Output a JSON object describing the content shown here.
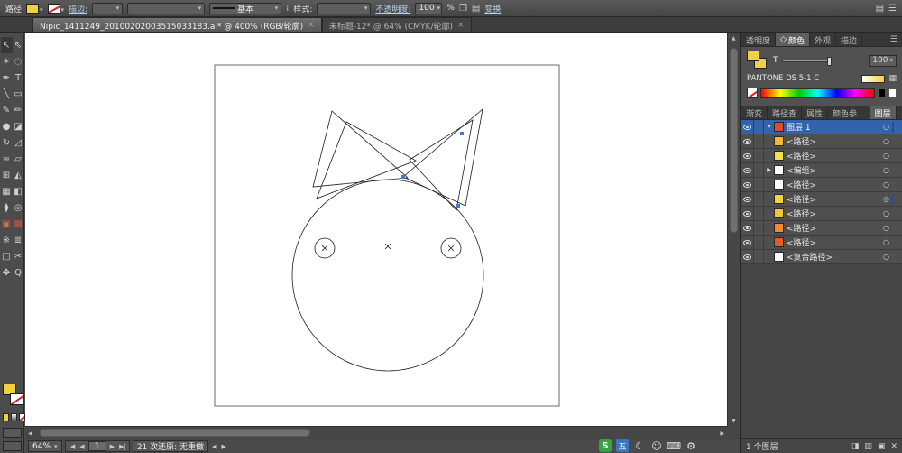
{
  "control_bar": {
    "selection_label": "路径",
    "stroke_link": "描边:",
    "profile_value": "基本",
    "style_label": "样式:",
    "opacity_link": "不透明度:",
    "opacity_value": "100",
    "percent": "%",
    "transform_link": "变换"
  },
  "document_tabs": {
    "active_title": "Nipic_1411249_20100202003515033183.ai* @ 400% (RGB/轮廓)",
    "inactive_title": "未标题-12* @ 64% (CMYK/轮廓)"
  },
  "toolbar": {
    "tools": [
      {
        "name": "selection-tool",
        "glyph": "↖"
      },
      {
        "name": "direct-selection-tool",
        "glyph": "⇖"
      },
      {
        "name": "magic-wand-tool",
        "glyph": "✶"
      },
      {
        "name": "lasso-tool",
        "glyph": "◌"
      },
      {
        "name": "pen-tool",
        "glyph": "✒"
      },
      {
        "name": "type-tool",
        "glyph": "T"
      },
      {
        "name": "line-segment-tool",
        "glyph": "╲"
      },
      {
        "name": "rectangle-tool",
        "glyph": "▭"
      },
      {
        "name": "paintbrush-tool",
        "glyph": "✎"
      },
      {
        "name": "pencil-tool",
        "glyph": "✏"
      },
      {
        "name": "blob-brush-tool",
        "glyph": "●"
      },
      {
        "name": "eraser-tool",
        "glyph": "◪"
      },
      {
        "name": "rotate-tool",
        "glyph": "↻"
      },
      {
        "name": "scale-tool",
        "glyph": "◿"
      },
      {
        "name": "width-tool",
        "glyph": "≈"
      },
      {
        "name": "free-transform-tool",
        "glyph": "▱"
      },
      {
        "name": "shape-builder-tool",
        "glyph": "⊞"
      },
      {
        "name": "perspective-grid-tool",
        "glyph": "◭"
      },
      {
        "name": "mesh-tool",
        "glyph": "▦"
      },
      {
        "name": "gradient-tool",
        "glyph": "◧"
      },
      {
        "name": "eyedropper-tool",
        "glyph": "⧫"
      },
      {
        "name": "blend-tool",
        "glyph": "◎"
      },
      {
        "name": "live-paint-bucket-tool",
        "glyph": "▣",
        "color": "#e06a3c"
      },
      {
        "name": "live-paint-selection-tool",
        "glyph": "▩",
        "color": "#d05050"
      },
      {
        "name": "symbol-sprayer-tool",
        "glyph": "※"
      },
      {
        "name": "column-graph-tool",
        "glyph": "≣"
      },
      {
        "name": "artboard-tool",
        "glyph": "□"
      },
      {
        "name": "slice-tool",
        "glyph": "✂"
      },
      {
        "name": "hand-tool",
        "glyph": "✥"
      },
      {
        "name": "zoom-tool",
        "glyph": "Q"
      }
    ]
  },
  "panels": {
    "top_tabs": {
      "transparency": "透明度",
      "color": "颜色",
      "appearance": "外观",
      "stroke": "描边"
    },
    "color": {
      "tint_label": "T",
      "tint_value": "100",
      "swatch_name": "PANTONE DS 5-1 C",
      "fill_hex": "#f2d23c"
    },
    "mid_tabs": {
      "gradient": "渐变",
      "pathfinder": "路径查",
      "attributes": "属性",
      "color_guide": "颜色参...",
      "layers": "图层"
    },
    "layers": {
      "rows": [
        {
          "name": "图层 1",
          "color": "#e04b2a"
        },
        {
          "name": "<路径>",
          "color": "#f2b83a"
        },
        {
          "name": "<路径>",
          "color": "#f4e14e"
        },
        {
          "name": "<编组>",
          "color": "#ffffff"
        },
        {
          "name": "<路径>",
          "color": "#ffffff"
        },
        {
          "name": "<路径>",
          "color": "#f4d23c"
        },
        {
          "name": "<路径>",
          "color": "#f2c43a"
        },
        {
          "name": "<路径>",
          "color": "#ef8b2b"
        },
        {
          "name": "<路径>",
          "color": "#e55a26"
        },
        {
          "name": "<复合路径>",
          "color": "#ffffff"
        }
      ],
      "status": "1 个图层"
    }
  },
  "status_bar": {
    "zoom": "64%",
    "page": "1",
    "undo_info": "21 次还原: 无重做"
  },
  "tray": {
    "sogou": "S",
    "wubi": "五"
  },
  "icons": {
    "caret_down": "▾",
    "close": "×",
    "menu": "☰",
    "dots": "⁞",
    "doc": "❐",
    "rows": "▤",
    "diamond": "◇",
    "target": "○",
    "target_selected": "◎",
    "expander_open": "▼",
    "expander_closed": "▶",
    "nav_first": "|◀",
    "nav_prev": "◀",
    "nav_next": "▶",
    "nav_last": "▶|",
    "undo_prev": "◀",
    "undo_next": "▶",
    "scroll_up": "▲",
    "scroll_down": "▼",
    "scroll_left": "◀",
    "scroll_right": "▶",
    "moon": "☾",
    "smiley": "☺",
    "keyboard": "⌨",
    "gear": "⚙",
    "grid": "▦",
    "clip_mask": "◨",
    "new_sublayer": "▥",
    "new_layer": "▣",
    "delete": "✕",
    "resize_grip": "◢"
  },
  "colors": {
    "selection_blue": "#3263ac",
    "anchor_blue": "#3f7ad6",
    "accent_yellow": "#f2d23c"
  }
}
